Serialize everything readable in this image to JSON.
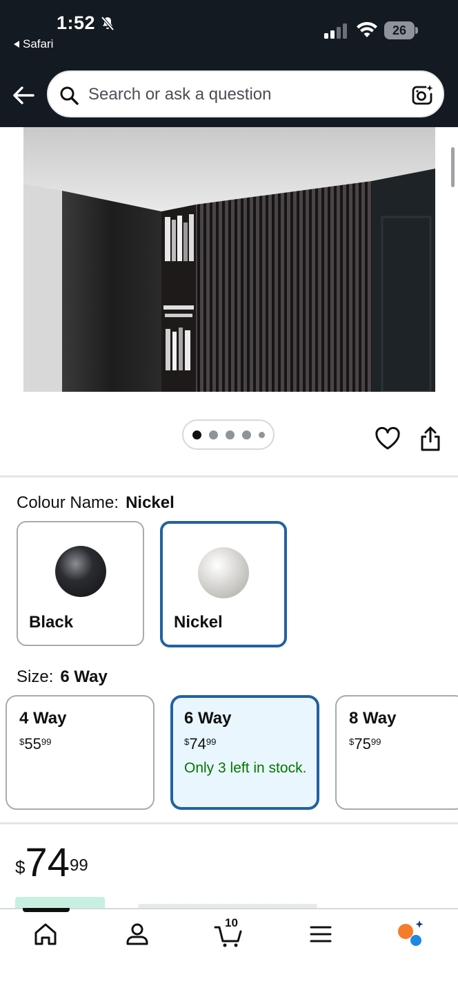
{
  "status_bar": {
    "time": "1:52",
    "back_app": "Safari",
    "battery": "26"
  },
  "search": {
    "placeholder": "Search or ask a question"
  },
  "gallery": {
    "image_count": 5,
    "active_index": 0
  },
  "colour": {
    "label": "Colour Name:",
    "selected": "Nickel",
    "options": [
      {
        "name": "Black",
        "color": "#2a2c30"
      },
      {
        "name": "Nickel",
        "color": "#d8d6d3"
      }
    ]
  },
  "size": {
    "label": "Size:",
    "selected": "6 Way",
    "options": [
      {
        "name": "4 Way",
        "currency": "$",
        "whole": "55",
        "fraction": "99",
        "stock": ""
      },
      {
        "name": "6 Way",
        "currency": "$",
        "whole": "74",
        "fraction": "99",
        "stock": "Only 3 left in stock."
      },
      {
        "name": "8 Way",
        "currency": "$",
        "whole": "75",
        "fraction": "99",
        "stock": ""
      }
    ]
  },
  "price": {
    "currency": "$",
    "whole": "74",
    "fraction": "99"
  },
  "tabbar": {
    "cart_count": "10",
    "accent_color": "#f57c2b",
    "ai_color": "#1e88e5"
  }
}
